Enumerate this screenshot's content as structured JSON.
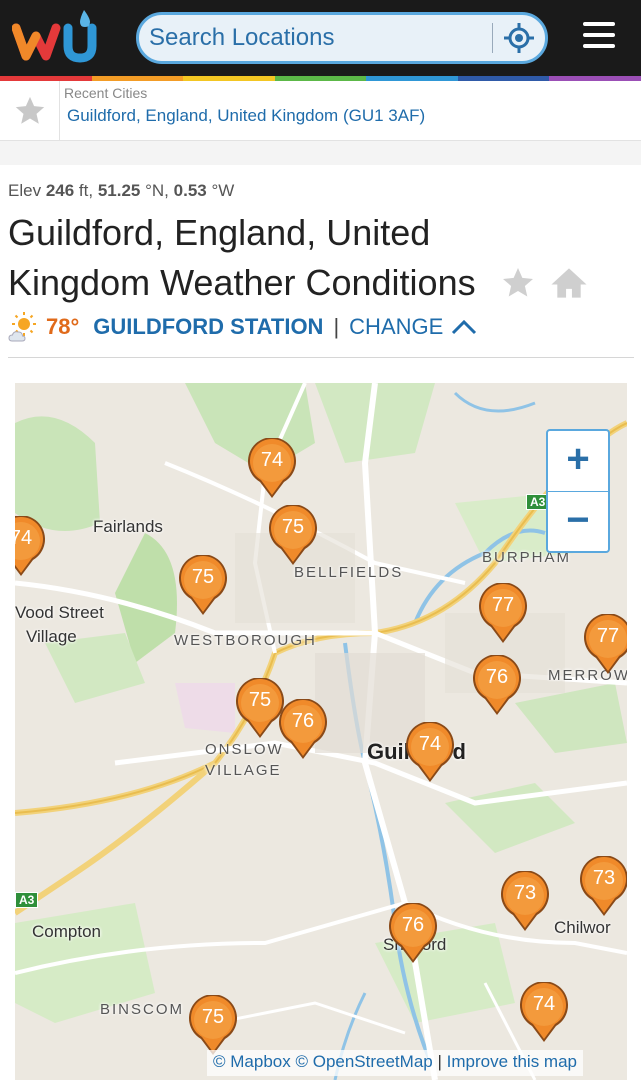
{
  "header": {
    "search_placeholder": "Search Locations",
    "rainbow": [
      "#e4393a",
      "#f39c26",
      "#f3c623",
      "#5cb848",
      "#2f97d6",
      "#2f5aa8",
      "#9b4fb6"
    ]
  },
  "recent": {
    "label": "Recent Cities",
    "city": "Guildford, England, United Kingdom (GU1 3AF)"
  },
  "location": {
    "elev_label": "Elev",
    "elev_value": "246",
    "elev_unit": "ft,",
    "lat_value": "51.25",
    "lat_unit": "°N,",
    "lon_value": "0.53",
    "lon_unit": "°W",
    "title": "Guildford, England, United Kingdom Weather Conditions",
    "temp": "78°",
    "station": "GUILDFORD STATION",
    "separator": "|",
    "change": "CHANGE"
  },
  "map": {
    "places": {
      "fairlands": "Fairlands",
      "bellfields": "BELLFIELDS",
      "burpham": "BURPHAM",
      "wood_street_1": "Vood Street",
      "wood_street_2": "Village",
      "westborough": "WESTBOROUGH",
      "merrow": "MERROW",
      "onslow_1": "ONSLOW",
      "onslow_2": "VILLAGE",
      "guildford": "Guildford",
      "compton": "Compton",
      "chilworth": "Chilwor",
      "shalford": "Shalford",
      "binscombe": "BINSCOM",
      "a3_top": "A3",
      "a3_left": "A3"
    },
    "pins": [
      "74",
      "75",
      "74",
      "75",
      "77",
      "77",
      "76",
      "75",
      "76",
      "74",
      "73",
      "73",
      "76",
      "74",
      "75"
    ],
    "zoom_in": "+",
    "zoom_out": "−",
    "attrib_mapbox": "© Mapbox",
    "attrib_osm": "© OpenStreetMap",
    "attrib_sep": "|",
    "attrib_improve": "Improve this map"
  }
}
